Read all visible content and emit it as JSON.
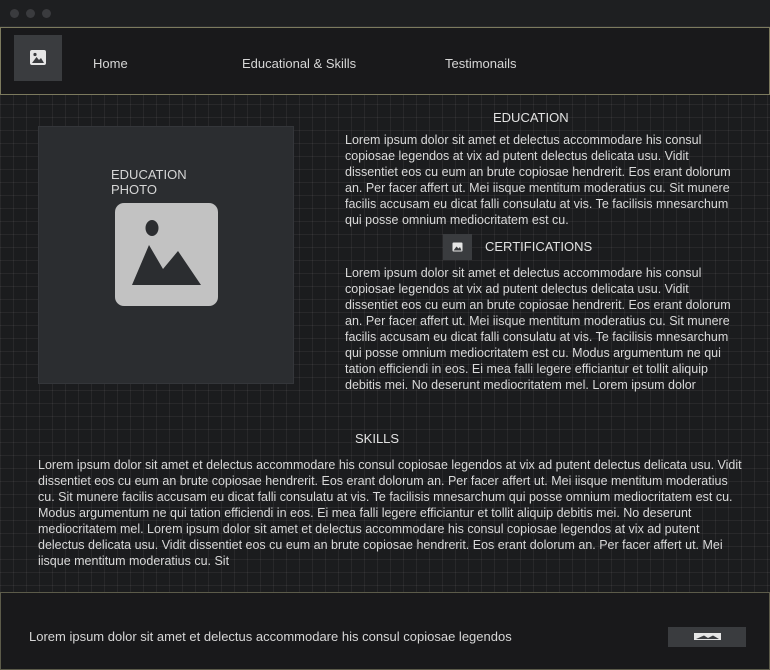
{
  "nav": {
    "items": [
      {
        "label": "Home"
      },
      {
        "label": "Educational & Skills"
      },
      {
        "label": "Testimonails"
      }
    ]
  },
  "education": {
    "photo_caption": "EDUCATION PHOTO",
    "title": "EDUCATION",
    "text": "Lorem ipsum dolor sit amet et delectus accommodare his consul copiosae legendos at vix ad putent delectus delicata usu. Vidit dissentiet eos cu eum an brute copiosae hendrerit. Eos erant dolorum an. Per facer affert ut. Mei iisque mentitum moderatius cu. Sit munere facilis accusam eu dicat falli consulatu at vis. Te facilisis mnesarchum qui posse omnium mediocritatem est cu."
  },
  "certifications": {
    "title": "CERTIFICATIONS",
    "text": "Lorem ipsum dolor sit amet et delectus accommodare his consul copiosae legendos at vix ad putent delectus delicata usu. Vidit dissentiet eos cu eum an brute copiosae hendrerit. Eos erant dolorum an. Per facer affert ut. Mei iisque mentitum moderatius cu. Sit munere facilis accusam eu dicat falli consulatu at vis. Te facilisis mnesarchum qui posse omnium mediocritatem est cu. Modus argumentum ne qui tation efficiendi in eos. Ei mea falli legere efficiantur et tollit aliquip debitis mei. No deserunt mediocritatem mel. Lorem ipsum dolor"
  },
  "skills": {
    "title": "SKILLS",
    "text": "Lorem ipsum dolor sit amet et delectus accommodare his consul copiosae legendos at vix ad putent delectus delicata usu. Vidit dissentiet eos cu eum an brute copiosae hendrerit. Eos erant dolorum an. Per facer affert ut. Mei iisque mentitum moderatius cu. Sit munere facilis accusam eu dicat falli consulatu at vis. Te facilisis mnesarchum qui posse omnium mediocritatem est cu. Modus argumentum ne qui tation efficiendi in eos. Ei mea falli legere efficiantur et tollit aliquip debitis mei. No deserunt mediocritatem mel. Lorem ipsum dolor sit amet et delectus accommodare his consul copiosae legendos at vix ad putent delectus delicata usu. Vidit dissentiet eos cu eum an brute copiosae hendrerit. Eos erant dolorum an. Per facer affert ut. Mei iisque mentitum moderatius cu. Sit"
  },
  "footer": {
    "text": "Lorem ipsum dolor sit amet et delectus accommodare his consul copiosae legendos"
  },
  "icons": {
    "logo": "image-icon",
    "photo": "image-placeholder-icon",
    "certifications": "image-icon",
    "footer_button": "image-icon"
  },
  "colors": {
    "background": "#1b1c1e",
    "navbar_border": "#7c7a5e",
    "placeholder": "#c2c2c2"
  }
}
